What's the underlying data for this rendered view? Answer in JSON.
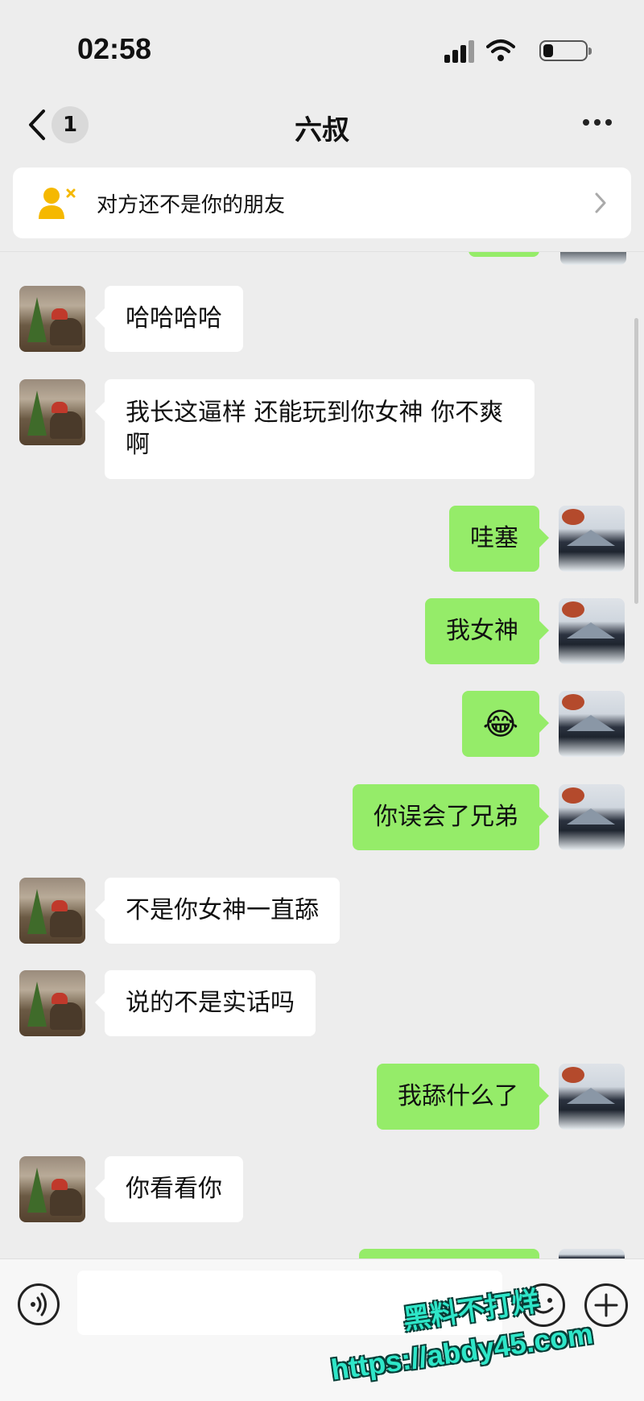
{
  "status_bar": {
    "time": "02:58",
    "icons": [
      "cellular-signal-icon",
      "wifi-icon",
      "battery-icon"
    ]
  },
  "nav": {
    "back_icon": "chevron-left-icon",
    "unread_count": "1",
    "title": "六叔",
    "more_icon": "more-dots-icon"
  },
  "banner": {
    "icon": "not-friend-person-icon",
    "text": "对方还不是你的朋友",
    "chevron_icon": "chevron-right-icon"
  },
  "messages": [
    {
      "sender": "them",
      "text": "哈哈哈哈"
    },
    {
      "sender": "them",
      "text": "我长这逼样 还能玩到你女神 你不爽啊"
    },
    {
      "sender": "me",
      "text": "哇塞"
    },
    {
      "sender": "me",
      "text": "我女神"
    },
    {
      "sender": "me",
      "text": "😂"
    },
    {
      "sender": "me",
      "text": "你误会了兄弟"
    },
    {
      "sender": "them",
      "text": "不是你女神一直舔"
    },
    {
      "sender": "them",
      "text": "说的不是实话吗"
    },
    {
      "sender": "me",
      "text": "我舔什么了"
    },
    {
      "sender": "them",
      "text": "你看看你"
    }
  ],
  "input_bar": {
    "voice_icon": "voice-icon",
    "input_value": "",
    "emoji_icon": "emoji-smiley-icon",
    "plus_icon": "plus-icon"
  },
  "watermark": {
    "line1": "黑料不打烊",
    "line2": "https://abdy45.com"
  },
  "colors": {
    "background": "#ededed",
    "my_bubble": "#95ec69",
    "their_bubble": "#ffffff",
    "banner_icon": "#f5b800"
  }
}
